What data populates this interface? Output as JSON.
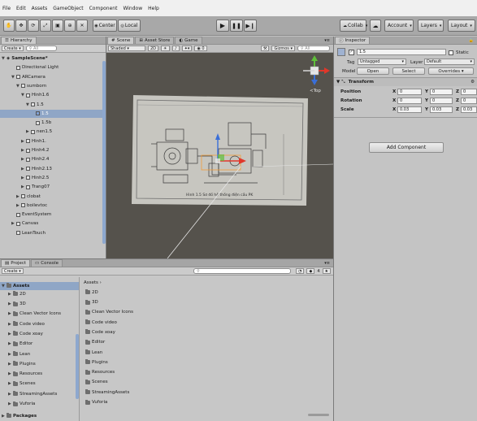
{
  "menu": [
    "File",
    "Edit",
    "Assets",
    "GameObject",
    "Component",
    "Window",
    "Help"
  ],
  "toolbar": {
    "center_label": "Center",
    "local_label": "Local",
    "collab_label": "Collab",
    "account_label": "Account",
    "layers_label": "Layers",
    "layout_label": "Layout"
  },
  "hierarchy": {
    "tab": "Hierarchy",
    "create_label": "Create",
    "search_placeholder": "All",
    "rows": [
      {
        "label": "SampleScene*",
        "indent": 0,
        "arrow": "▼",
        "scene": true
      },
      {
        "label": "Directional Light",
        "indent": 2,
        "arrow": ""
      },
      {
        "label": "ARCamera",
        "indent": 2,
        "arrow": "▼"
      },
      {
        "label": "sumborn",
        "indent": 3,
        "arrow": "▼"
      },
      {
        "label": "Hinh1.6",
        "indent": 4,
        "arrow": "▼"
      },
      {
        "label": "1.5",
        "indent": 5,
        "arrow": "▼"
      },
      {
        "label": "1.5",
        "indent": 6,
        "arrow": "",
        "selected": true
      },
      {
        "label": "1.5b",
        "indent": 6,
        "arrow": ""
      },
      {
        "label": "nen1.5",
        "indent": 5,
        "arrow": "▶"
      },
      {
        "label": "Hinh1.",
        "indent": 4,
        "arrow": "▶"
      },
      {
        "label": "Hinh4.2",
        "indent": 4,
        "arrow": "▶"
      },
      {
        "label": "Hinh2.4",
        "indent": 4,
        "arrow": "▶"
      },
      {
        "label": "Hinh2.13",
        "indent": 4,
        "arrow": "▶"
      },
      {
        "label": "Hinh2.5",
        "indent": 4,
        "arrow": "▶"
      },
      {
        "label": "Trang07",
        "indent": 4,
        "arrow": "▶"
      },
      {
        "label": "clobat",
        "indent": 3,
        "arrow": "▶"
      },
      {
        "label": "boilevtoc",
        "indent": 3,
        "arrow": "▶"
      },
      {
        "label": "EventSystem",
        "indent": 2,
        "arrow": ""
      },
      {
        "label": "Canvas",
        "indent": 2,
        "arrow": "▶"
      },
      {
        "label": "LeanTouch",
        "indent": 2,
        "arrow": ""
      }
    ]
  },
  "scene": {
    "tabs": [
      "Scene",
      "Asset Store",
      "Game"
    ],
    "shading": "Shaded",
    "dim_label": "2D",
    "gizmos_label": "Gizmos",
    "search_placeholder": "All",
    "persp_label": "<Top",
    "doc_caption": "Hình 1.5 Sơ đồ hệ thống điện cầu PK"
  },
  "inspector": {
    "tab": "Inspector",
    "object_name": "1.5",
    "static_label": "Static",
    "tag_label": "Tag",
    "tag_value": "Untagged",
    "layer_label": "Layer",
    "layer_value": "Default",
    "model_label": "Model",
    "open_label": "Open",
    "select_label": "Select",
    "overrides_label": "Overrides",
    "transform_label": "Transform",
    "position_label": "Position",
    "position": {
      "x": "0",
      "y": "0",
      "z": "0"
    },
    "rotation_label": "Rotation",
    "rotation": {
      "x": "0",
      "y": "0",
      "z": "0"
    },
    "scale_label": "Scale",
    "scale": {
      "x": "0.03",
      "y": "0.03",
      "z": "0.03"
    },
    "add_component": "Add Component"
  },
  "project": {
    "tabs": [
      "Project",
      "Console"
    ],
    "create_label": "Create",
    "search_placeholder": "",
    "breadcrumb": "Assets",
    "visible_count": "4",
    "tree_root": "Assets",
    "tree": [
      "2D",
      "3D",
      "Clean Vector Icons",
      "Code video",
      "Code xoay",
      "Editor",
      "Lean",
      "Plugins",
      "Resources",
      "Scenes",
      "StreamingAssets",
      "Vuforia"
    ],
    "packages_label": "Packages",
    "files": [
      "2D",
      "3D",
      "Clean Vector Icons",
      "Code video",
      "Code xoay",
      "Editor",
      "Lean",
      "Plugins",
      "Resources",
      "Scenes",
      "StreamingAssets",
      "Vuforia"
    ]
  },
  "colors": {
    "selection": "#8fa6c6",
    "scene_bg": "#5a5752",
    "axis_x": "#e0372a",
    "axis_y": "#5fbf3a",
    "axis_z": "#3a6fd8"
  }
}
